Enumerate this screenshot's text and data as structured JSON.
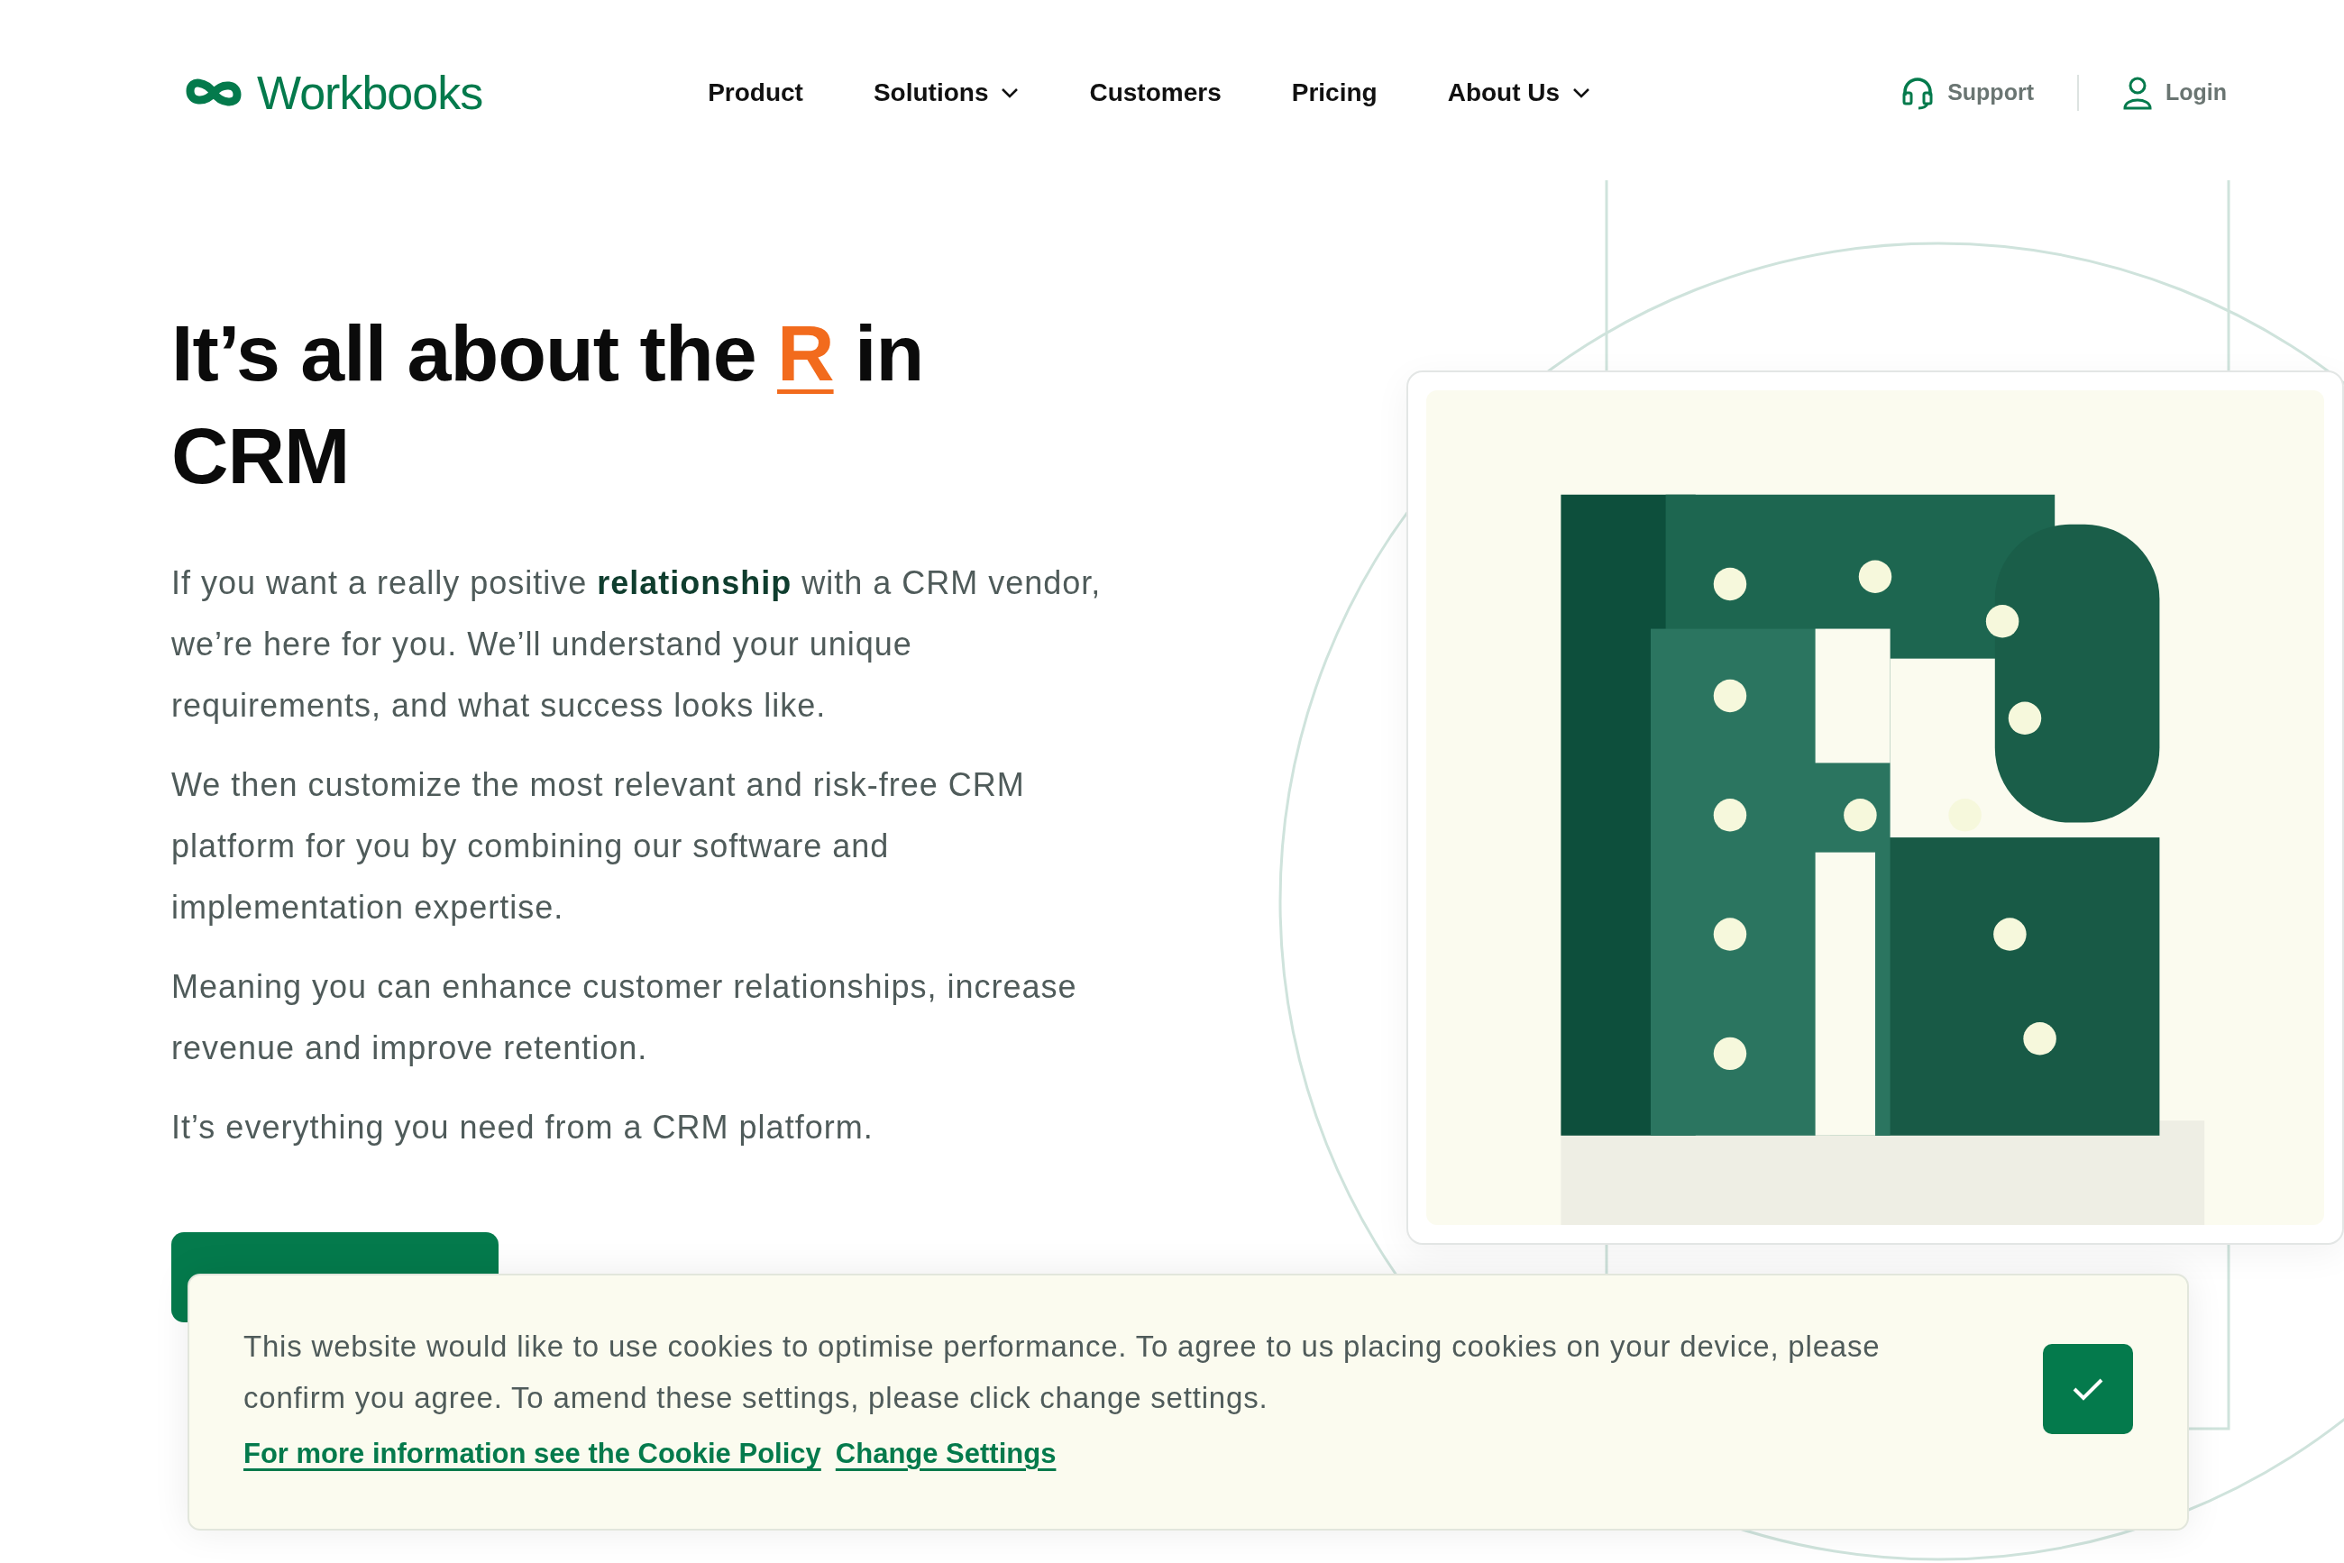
{
  "header": {
    "logo": "Workbooks",
    "nav": [
      {
        "label": "Product",
        "dropdown": false
      },
      {
        "label": "Solutions",
        "dropdown": true
      },
      {
        "label": "Customers",
        "dropdown": false
      },
      {
        "label": "Pricing",
        "dropdown": false
      },
      {
        "label": "About Us",
        "dropdown": true
      }
    ],
    "support": "Support",
    "login": "Login"
  },
  "hero": {
    "heading": {
      "before": "It’s all about the",
      "highlight": "R",
      "after": "in CRM"
    },
    "paragraphs": [
      "If you want a really positive **relationship** with a CRM vendor, we’re here for you. We’ll understand your unique requirements, and what success looks like.",
      "We then customize the most relevant and risk-free CRM platform for you by combining our software and implementation expertise.",
      "Meaning you can enhance customer relationships, increase revenue and improve retention.",
      "It’s everything you need from a CRM platform."
    ],
    "image": {
      "kind": "picture"
    }
  },
  "cookie_banner": {
    "message": "This website would like to use cookies to optimise performance. To agree to us placing cookies on your device, please confirm you agree. To amend these settings, please click change settings.",
    "links": [
      "For more information see the Cookie Policy",
      "Change Settings"
    ]
  }
}
